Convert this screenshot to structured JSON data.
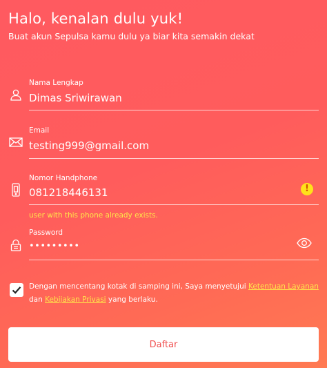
{
  "header": {
    "title": "Halo, kenalan dulu yuk!",
    "subtitle": "Buat akun Sepulsa kamu dulu ya biar kita semakin dekat"
  },
  "form": {
    "name": {
      "label": "Nama Lengkap",
      "value": "Dimas Sriwirawan",
      "icon": "user-icon"
    },
    "email": {
      "label": "Email",
      "value": "testing999@gmail.com",
      "icon": "envelope-icon"
    },
    "phone": {
      "label": "Nomor Handphone",
      "value": "081218446131",
      "icon": "phone-icon",
      "warning_icon": "!",
      "error": "user with this phone already exists."
    },
    "password": {
      "label": "Password",
      "value": "•••••••••",
      "icon": "lock-icon",
      "toggle_icon": "eye-icon"
    }
  },
  "agreement": {
    "checked": true,
    "text_before": "Dengan mencentang kotak di samping ini, Saya menyetujui ",
    "terms_link": "Ketentuan Layanan",
    "text_middle": " dan ",
    "privacy_link": "Kebijakan Privasi",
    "text_after": " yang berlaku."
  },
  "submit_label": "Daftar",
  "colors": {
    "accent": "#ff5a5f",
    "warning": "#ffe21a",
    "link": "#ffe84a",
    "button_text": "#f04e4e"
  }
}
